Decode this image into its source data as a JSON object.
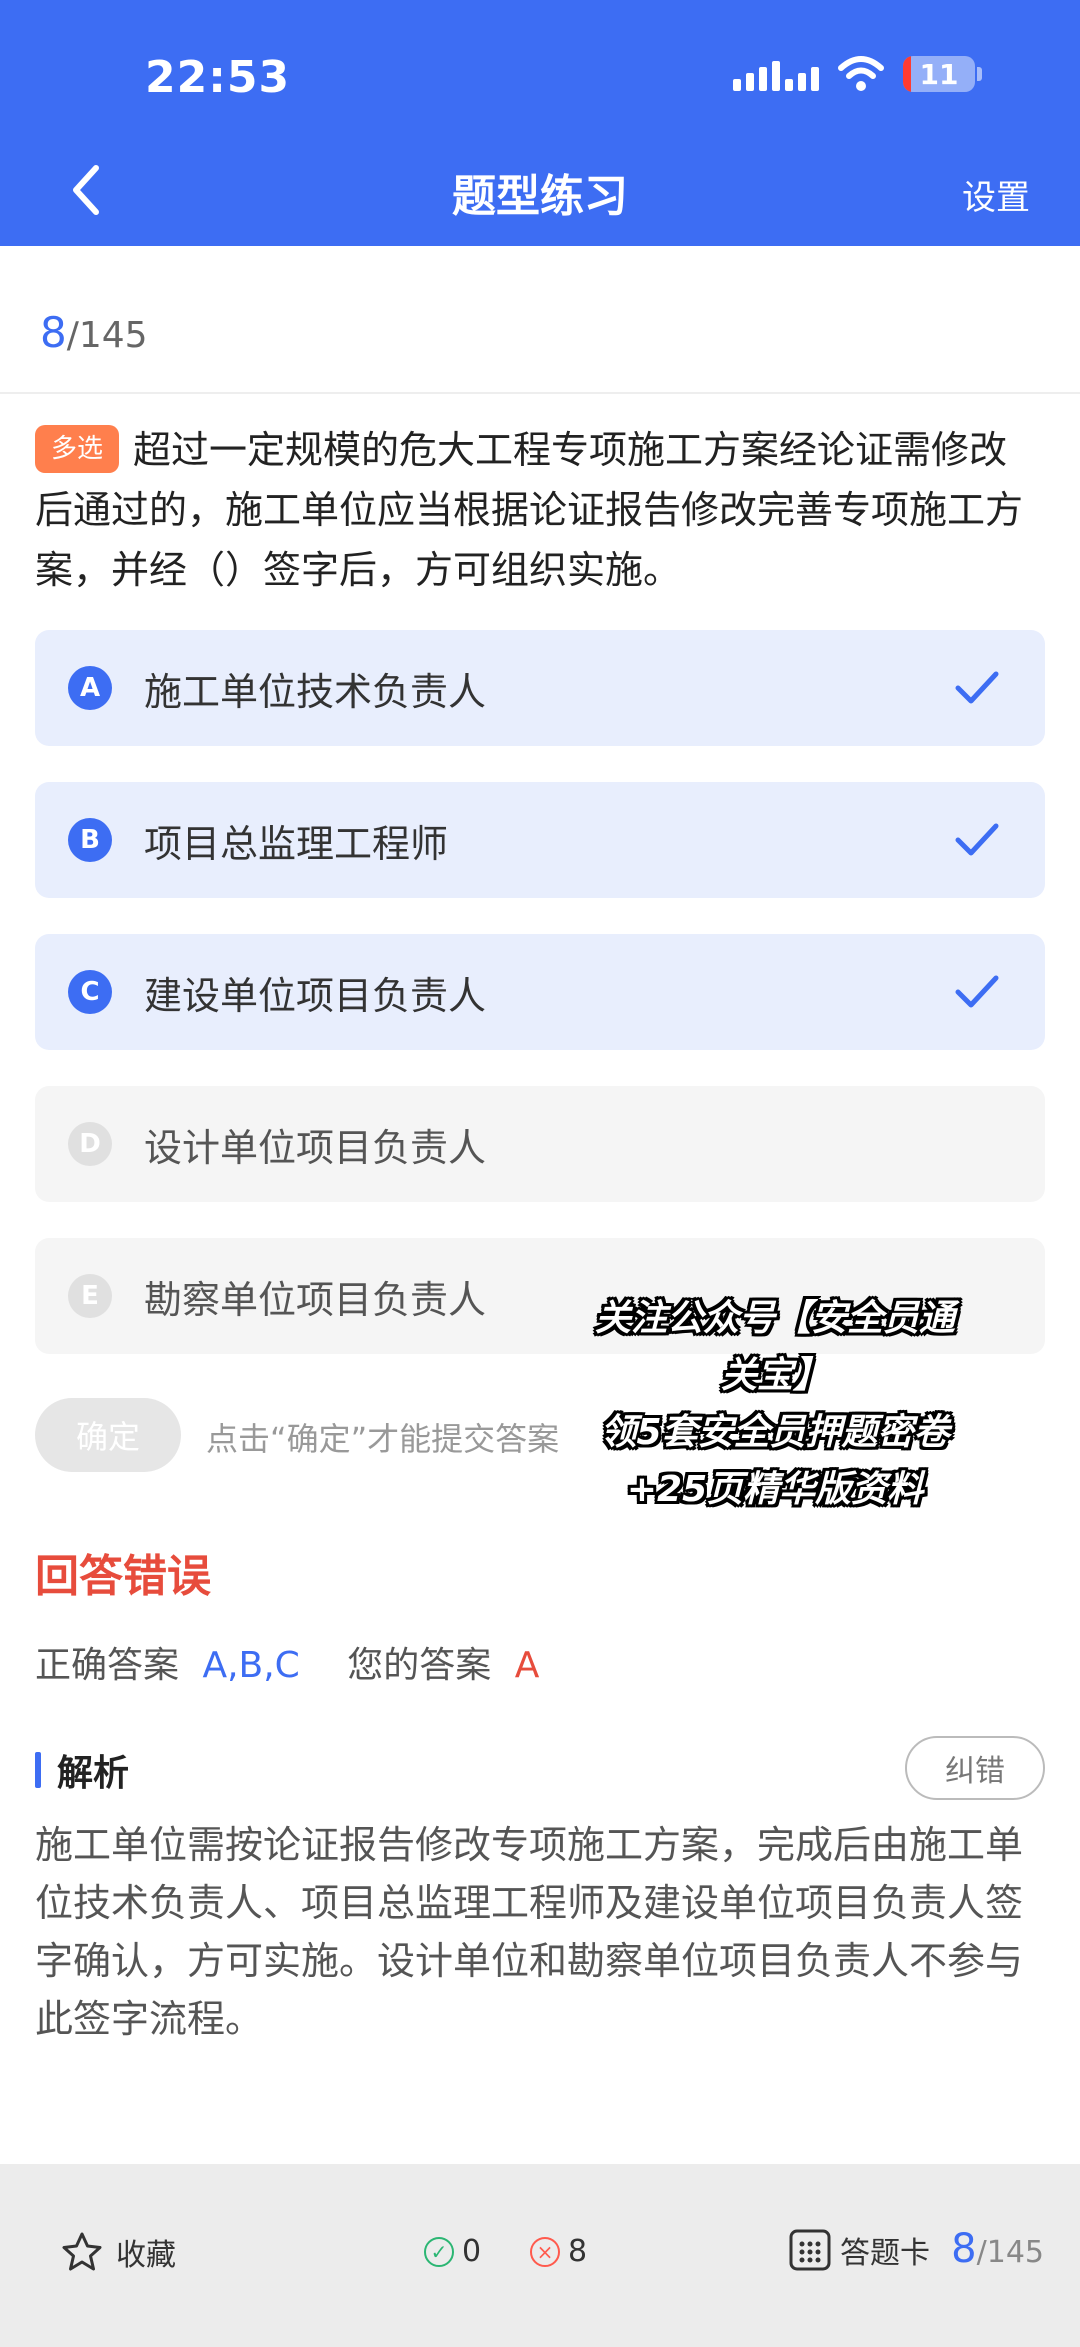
{
  "status_bar": {
    "time": "22:53",
    "battery": "11"
  },
  "nav": {
    "title": "题型练习",
    "settings_label": "设置"
  },
  "progress": {
    "current": "8",
    "total": "/145"
  },
  "question": {
    "type_tag": "多选",
    "text": "超过一定规模的危大工程专项施工方案经论证需修改后通过的，施工单位应当根据论证报告修改完善专项施工方案，并经（）签字后，方可组织实施。"
  },
  "options": [
    {
      "letter": "A",
      "text": "施工单位技术负责人",
      "selected": true
    },
    {
      "letter": "B",
      "text": "项目总监理工程师",
      "selected": true
    },
    {
      "letter": "C",
      "text": "建设单位项目负责人",
      "selected": true
    },
    {
      "letter": "D",
      "text": "设计单位项目负责人",
      "selected": false
    },
    {
      "letter": "E",
      "text": "勘察单位项目负责人",
      "selected": false
    }
  ],
  "confirm": {
    "label": "确定",
    "hint": "点击“确定”才能提交答案"
  },
  "promo": {
    "line1": "关注公众号【安全员通",
    "line2": "关宝】",
    "line3": "领5套安全员押题密卷",
    "line4": "+25页精华版资料"
  },
  "result": {
    "title": "回答错误",
    "correct_label": "正确答案",
    "correct_value": "A,B,C",
    "yours_label": "您的答案",
    "yours_value": "A"
  },
  "analysis": {
    "title": "解析",
    "report_label": "纠错",
    "text": "施工单位需按论证报告修改专项施工方案，完成后由施工单位技术负责人、项目总监理工程师及建设单位项目负责人签字确认，方可实施。设计单位和勘察单位项目负责人不参与此签字流程。"
  },
  "bottom": {
    "favorite_label": "收藏",
    "correct_count": "0",
    "wrong_count": "8",
    "card_label": "答题卡",
    "progress_current": "8",
    "progress_total": "/145"
  },
  "colors": {
    "primary": "#3d6df3",
    "error": "#e74c3c",
    "tag": "#ff7f4d",
    "selected_bg": "#e8eefd"
  }
}
